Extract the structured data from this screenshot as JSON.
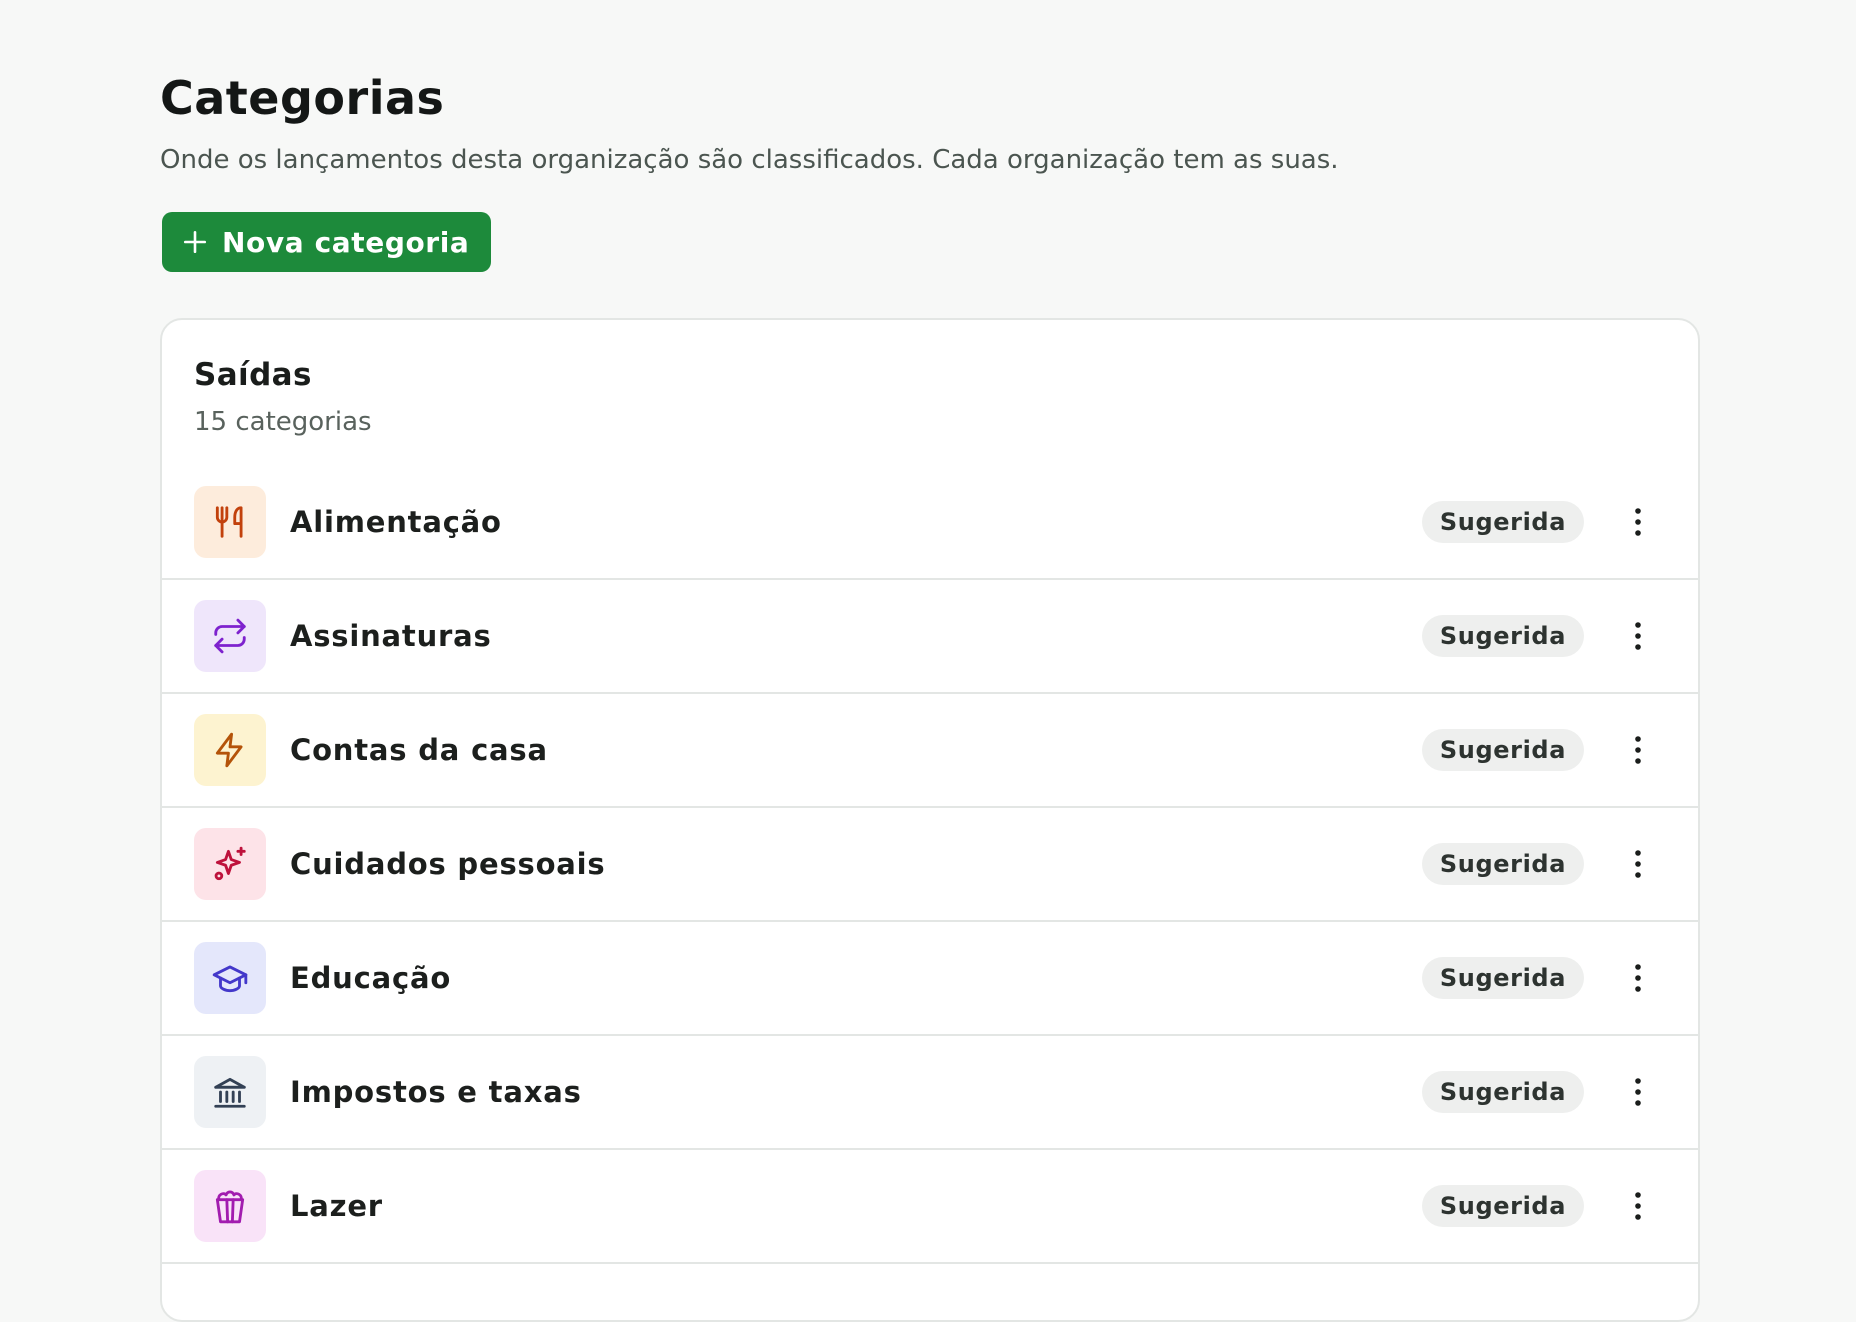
{
  "header": {
    "title": "Categorias",
    "subtitle": "Onde os lançamentos desta organização são classificados. Cada organização tem as suas.",
    "new_button_label": "Nova categoria"
  },
  "colors": {
    "primary": "#1d8a3b",
    "page_background": "#f7f8f7",
    "card_background": "#ffffff",
    "border": "#e3e6e4",
    "badge_background": "#eeefee"
  },
  "section": {
    "title": "Saídas",
    "count_label": "15 categorias",
    "items": [
      {
        "label": "Alimentação",
        "badge": "Sugerida",
        "icon": "utensils-icon",
        "icon_color": "#c2410c",
        "icon_bg": "#fdecdc"
      },
      {
        "label": "Assinaturas",
        "badge": "Sugerida",
        "icon": "repeat-icon",
        "icon_color": "#7e22ce",
        "icon_bg": "#efe6fb"
      },
      {
        "label": "Contas da casa",
        "badge": "Sugerida",
        "icon": "lightning-icon",
        "icon_color": "#b45309",
        "icon_bg": "#fdf3d0"
      },
      {
        "label": "Cuidados pessoais",
        "badge": "Sugerida",
        "icon": "sparkles-icon",
        "icon_color": "#be123c",
        "icon_bg": "#fde3e8"
      },
      {
        "label": "Educação",
        "badge": "Sugerida",
        "icon": "graduation-cap-icon",
        "icon_color": "#4338ca",
        "icon_bg": "#e4e7fb"
      },
      {
        "label": "Impostos e taxas",
        "badge": "Sugerida",
        "icon": "bank-icon",
        "icon_color": "#334155",
        "icon_bg": "#eef1f4"
      },
      {
        "label": "Lazer",
        "badge": "Sugerida",
        "icon": "popcorn-icon",
        "icon_color": "#a21caf",
        "icon_bg": "#f9e3f8"
      }
    ]
  }
}
